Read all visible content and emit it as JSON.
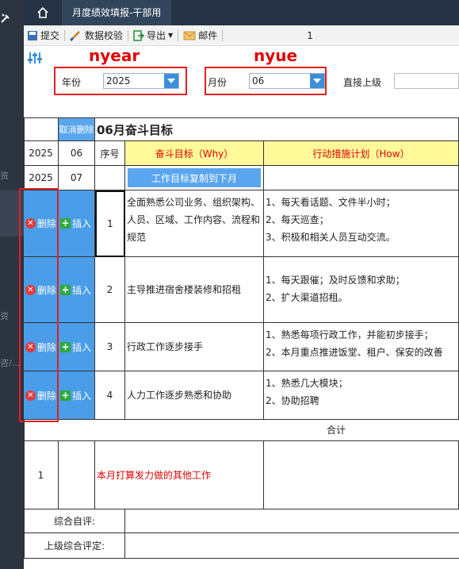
{
  "sidebar": {
    "text1": "资",
    "text2": "资",
    "text3": "咨/..."
  },
  "topbar": {
    "tab_title": "月度绩效填报-干部用"
  },
  "toolbar": {
    "submit": "提交",
    "validate": "数据校验",
    "export": "导出",
    "mail": "邮件",
    "page": "1"
  },
  "annotations": {
    "year_param": "nyear",
    "month_param": "nyue"
  },
  "params": {
    "year_label": "年份",
    "year_value": "2025",
    "month_label": "月份",
    "month_value": "06",
    "supervisor_label": "直接上级",
    "supervisor_value": ""
  },
  "report": {
    "cancel_delete": "取消删除",
    "title": "06月奋斗目标",
    "row_year": "2025",
    "row_month": "06",
    "next_year": "2025",
    "next_month": "07",
    "col_seq": "序号",
    "col_goal": "奋斗目标（Why）",
    "col_measure": "行动措施计划（How）",
    "copy_button": "工作目标复制到下月",
    "delete_label": "删除",
    "insert_label": "插入",
    "rows": [
      {
        "seq": "1",
        "goal": "全面熟悉公司业务、组织架构、人员、区域、工作内容、流程和规范",
        "measures": [
          "1、每天看话题、文件半小时；",
          "2、每天巡查；",
          "3、积极和相关人员互动交流。"
        ]
      },
      {
        "seq": "2",
        "goal": "主导推进宿舍楼装修和招租",
        "measures": [
          "1、每天跟催；及时反馈和求助；",
          "2、扩大渠道招租。"
        ]
      },
      {
        "seq": "3",
        "goal": "行政工作逐步接手",
        "measures": [
          "1、熟悉每项行政工作，并能初步接手；",
          "2、本月重点推进饭堂、租户、保安的改善"
        ]
      },
      {
        "seq": "4",
        "goal": "人力工作逐步熟悉和协助",
        "measures": [
          "1、熟悉几大模块；",
          "2、协助招聘"
        ]
      }
    ],
    "total_label": "合计",
    "other_seq": "1",
    "other_label": "本月打算发力做的其他工作",
    "self_eval_label": "综合自评:",
    "supervisor_eval_label": "上级综合评定:"
  }
}
